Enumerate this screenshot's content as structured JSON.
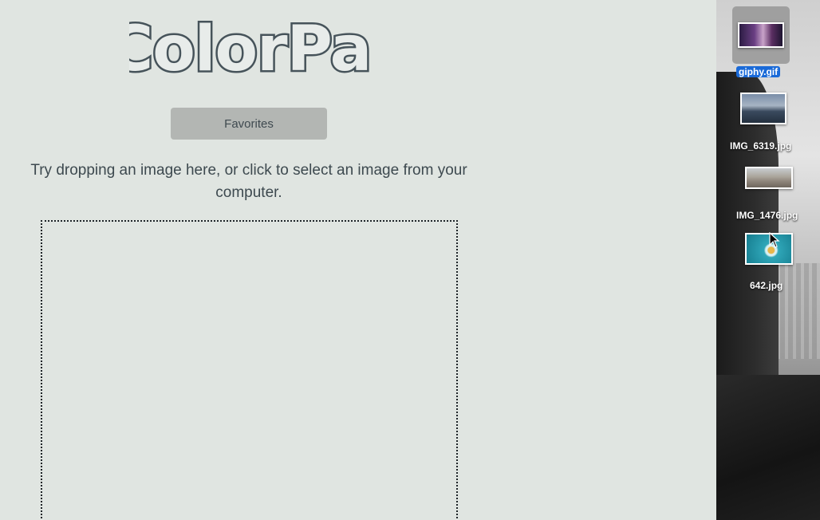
{
  "app": {
    "logo_text": "ColorPal",
    "favorites_label": "Favorites",
    "instructions": "Try dropping an image here, or click to select an image from your computer."
  },
  "desktop": {
    "files": [
      {
        "name": "giphy.gif",
        "selected": true
      },
      {
        "name": "IMG_6319.jpg",
        "selected": false
      },
      {
        "name": "IMG_1476.jpg",
        "selected": false
      },
      {
        "name": "642.jpg",
        "selected": false
      }
    ]
  },
  "colors": {
    "app_background": "#e0e5e1",
    "logo_outline": "#46535a",
    "button_background": "#b3b6b3",
    "text": "#3d494f",
    "selection_blue": "#1a6ad8"
  },
  "icons": {
    "cursor": "arrow-pointer-icon"
  }
}
